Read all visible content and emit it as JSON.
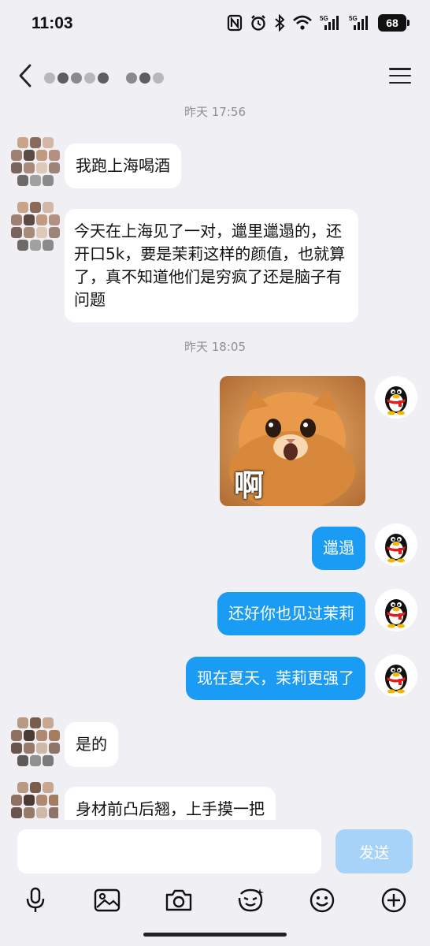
{
  "status_bar": {
    "time": "11:03",
    "network_1": "5G",
    "network_2": "5G",
    "battery": "68"
  },
  "header": {
    "back_icon": "chevron-left-icon",
    "contact_name_obscured": true,
    "menu_icon": "hamburger-menu-icon"
  },
  "chat": {
    "timestamps": [
      "昨天 17:56",
      "昨天 18:05"
    ],
    "messages": [
      {
        "side": "left",
        "text": "我跑上海喝酒"
      },
      {
        "side": "left",
        "text": "今天在上海见了一对，邋里邋遢的，还开口5k，要是茉莉这样的颜值，也就算了，真不知道他们是穷疯了还是脑子有问题"
      },
      {
        "side": "right",
        "type": "sticker",
        "text": "啊"
      },
      {
        "side": "right",
        "text": "邋遢"
      },
      {
        "side": "right",
        "text": "还好你也见过茉莉"
      },
      {
        "side": "right",
        "text": "现在夏天，茉莉更强了"
      },
      {
        "side": "left",
        "text": "是的"
      },
      {
        "side": "left",
        "text": "身材前凸后翘，上手摸一把"
      }
    ]
  },
  "input": {
    "placeholder": "",
    "send_label": "发送"
  },
  "toolbar": {
    "items": [
      "microphone-icon",
      "image-icon",
      "camera-icon",
      "sticker-face-icon",
      "emoji-icon",
      "plus-icon"
    ]
  },
  "colors": {
    "background": "#f0f0f4",
    "self_bubble": "#1a9bf4",
    "other_bubble": "#ffffff",
    "send_button_disabled": "#a8d3f8",
    "timestamp_text": "#8e8e93"
  }
}
